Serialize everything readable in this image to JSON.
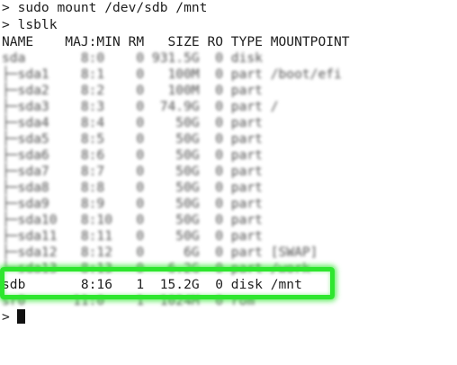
{
  "terminal": {
    "command_lines": [
      "> sudo mount /dev/sdb /mnt",
      "> lsblk"
    ],
    "table_header": "NAME    MAJ:MIN RM   SIZE RO TYPE MOUNTPOINT",
    "blurred_rows": [
      "sda       8:0    0 931.5G  0 disk",
      "├─sda1    8:1    0   100M  0 part /boot/efi",
      "├─sda2    8:2    0   100M  0 part",
      "├─sda3    8:3    0  74.9G  0 part /",
      "├─sda4    8:4    0    50G  0 part",
      "├─sda5    8:5    0    50G  0 part",
      "├─sda6    8:6    0    50G  0 part",
      "├─sda7    8:7    0    50G  0 part",
      "├─sda8    8:8    0    50G  0 part",
      "├─sda9    8:9    0    50G  0 part",
      "├─sda10   8:10   0    50G  0 part",
      "├─sda11   8:11   0    50G  0 part",
      "├─sda12   8:12   0     6G  0 part [SWAP]",
      "└─sda13   8:13   0   6.2G  0 part /work"
    ],
    "highlighted_row": "sdb       8:16   1  15.2G  0 disk /mnt",
    "blurred_row_after": "sr0      11:0    1  1024M  0 rom",
    "prompt": ">"
  },
  "colors": {
    "highlight_border": "#2ee62e",
    "text": "#202020",
    "background": "#ffffff"
  }
}
